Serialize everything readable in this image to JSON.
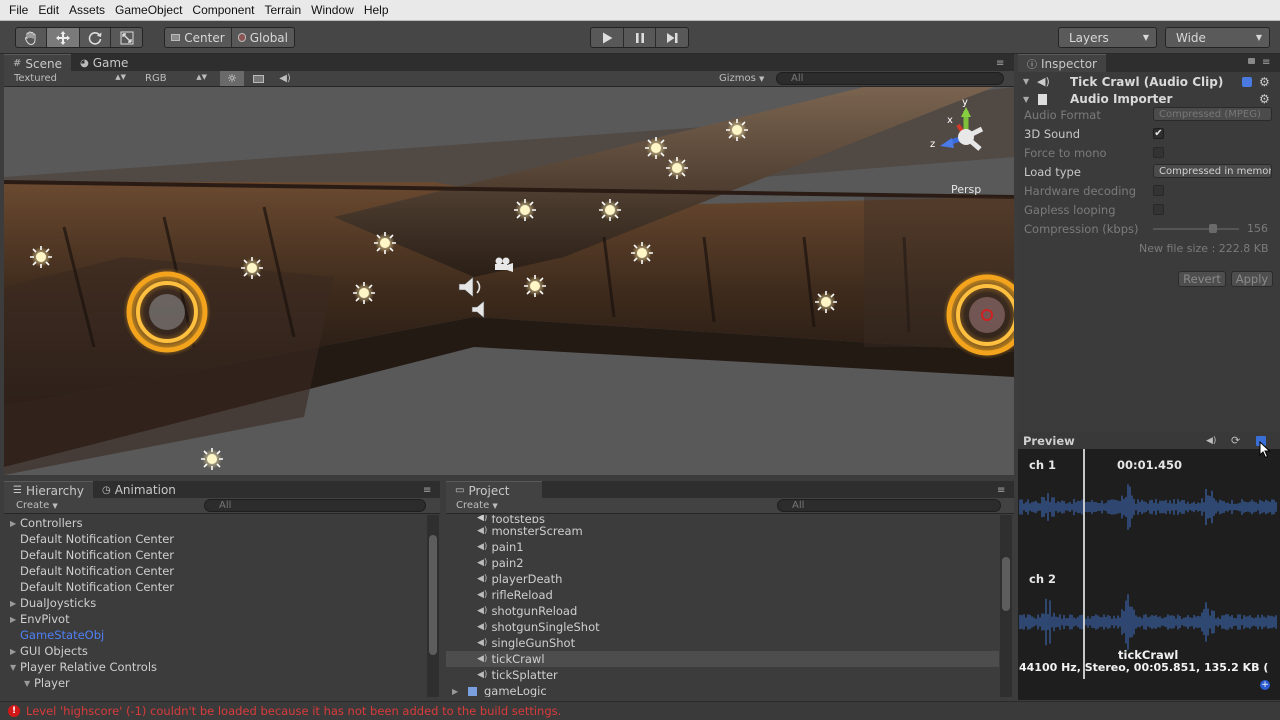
{
  "menu": [
    "File",
    "Edit",
    "Assets",
    "GameObject",
    "Component",
    "Terrain",
    "Window",
    "Help"
  ],
  "toolbar": {
    "pivot_center": "Center",
    "pivot_global": "Global",
    "layers": "Layers",
    "layout": "Wide"
  },
  "scene_panel": {
    "tabs": [
      "Scene",
      "Game"
    ],
    "render_mode": "Textured",
    "color_mode": "RGB",
    "gizmos": "Gizmos",
    "search_placeholder": "All",
    "projection": "Persp",
    "gizmo_axes": {
      "x": "x",
      "y": "y",
      "z": "z"
    }
  },
  "hierarchy": {
    "tabs": [
      "Hierarchy",
      "Animation"
    ],
    "create": "Create",
    "search_placeholder": "All",
    "items": [
      {
        "label": "Controllers",
        "foldable": true,
        "indent": 0,
        "highlight": false
      },
      {
        "label": "Default Notification Center",
        "foldable": false,
        "indent": 0,
        "highlight": false
      },
      {
        "label": "Default Notification Center",
        "foldable": false,
        "indent": 0,
        "highlight": false
      },
      {
        "label": "Default Notification Center",
        "foldable": false,
        "indent": 0,
        "highlight": false
      },
      {
        "label": "Default Notification Center",
        "foldable": false,
        "indent": 0,
        "highlight": false
      },
      {
        "label": "DualJoysticks",
        "foldable": true,
        "indent": 0,
        "highlight": false
      },
      {
        "label": "EnvPivot",
        "foldable": true,
        "indent": 0,
        "highlight": false
      },
      {
        "label": "GameStateObj",
        "foldable": false,
        "indent": 0,
        "highlight": true
      },
      {
        "label": "GUI Objects",
        "foldable": true,
        "indent": 0,
        "highlight": false
      },
      {
        "label": "Player Relative Controls",
        "foldable": true,
        "open": true,
        "indent": 0,
        "highlight": false
      },
      {
        "label": "Player",
        "foldable": true,
        "open": true,
        "indent": 1,
        "highlight": false
      }
    ]
  },
  "project": {
    "tab": "Project",
    "create": "Create",
    "search_placeholder": "All",
    "partial_top": "footsteps",
    "items": [
      {
        "label": "monsterScream",
        "selected": false
      },
      {
        "label": "pain1",
        "selected": false
      },
      {
        "label": "pain2",
        "selected": false
      },
      {
        "label": "playerDeath",
        "selected": false
      },
      {
        "label": "rifleReload",
        "selected": false
      },
      {
        "label": "shotgunReload",
        "selected": false
      },
      {
        "label": "shotgunSingleShot",
        "selected": false
      },
      {
        "label": "singleGunShot",
        "selected": false
      },
      {
        "label": "tickCrawl",
        "selected": true
      },
      {
        "label": "tickSplatter",
        "selected": false
      }
    ],
    "folder": "gameLogic"
  },
  "inspector": {
    "tab": "Inspector",
    "title": "Tick Crawl (Audio Clip)",
    "importer": "Audio Importer",
    "fields": {
      "audio_format_label": "Audio Format",
      "audio_format_value": "Compressed (MPEG)",
      "sound3d_label": "3D Sound",
      "force_mono_label": "Force to mono",
      "load_type_label": "Load type",
      "load_type_value": "Compressed in memory",
      "hw_decoding_label": "Hardware decoding",
      "gapless_label": "Gapless looping",
      "compression_label": "Compression (kbps)",
      "compression_value": "156",
      "compression_fraction": 0.7,
      "new_file_size": "New file size : 222.8 KB"
    },
    "sound3d_checked": true,
    "force_mono_checked": false,
    "hw_decoding_checked": false,
    "gapless_checked": false,
    "revert": "Revert",
    "apply": "Apply"
  },
  "preview": {
    "title": "Preview",
    "ch1": "ch 1",
    "ch2": "ch 2",
    "time": "00:01.450",
    "clip_name": "tickCrawl",
    "clip_info": "44100 Hz, Stereo, 00:05.851, 135.2 KB ("
  },
  "status": {
    "message": "Level 'highscore' (-1) couldn't be loaded because it has not been added to the build settings."
  },
  "colors": {
    "accent_blue": "#4f80f8",
    "error_red": "#d93b3b",
    "gold": "#f0a020"
  }
}
